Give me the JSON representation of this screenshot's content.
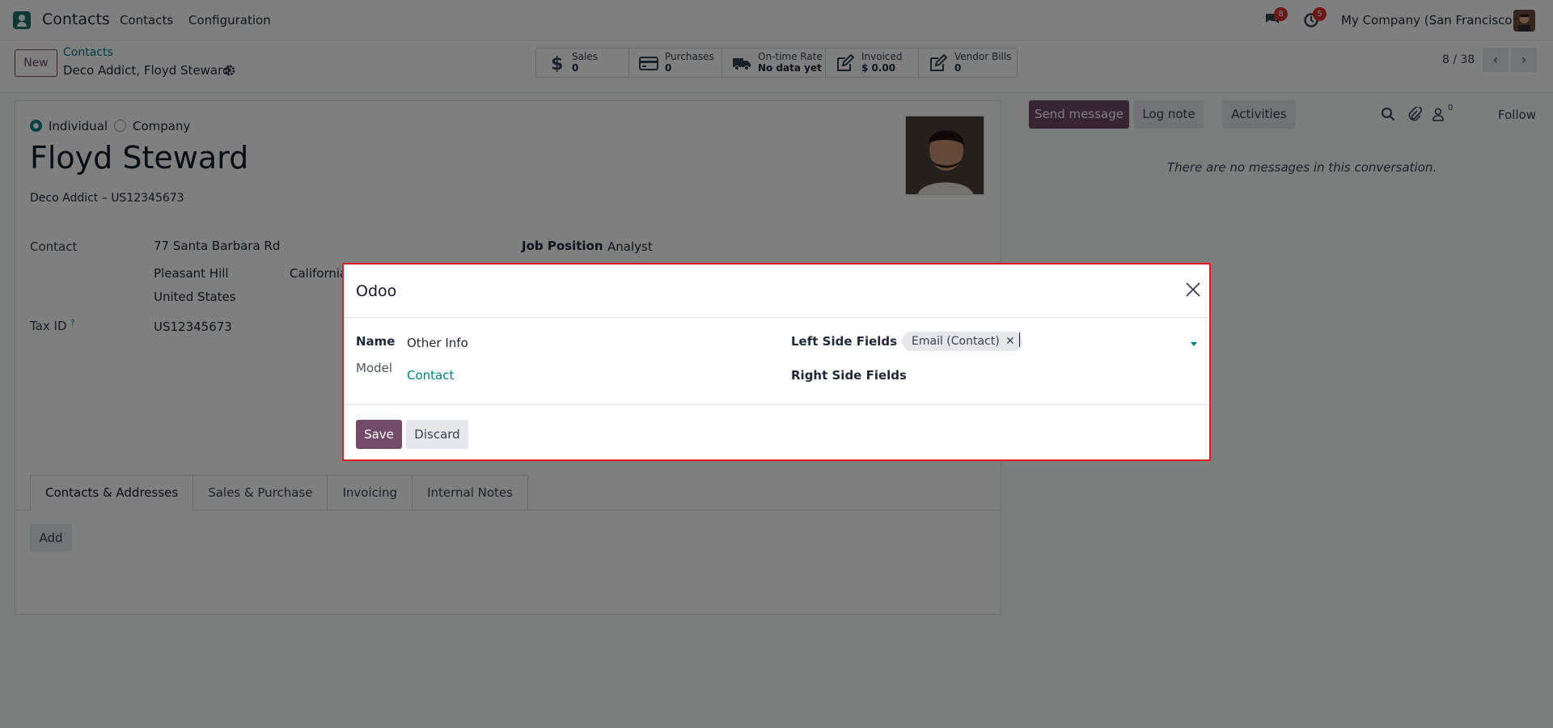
{
  "navbar": {
    "app_name": "Contacts",
    "menu": [
      "Contacts",
      "Configuration"
    ],
    "messages_badge": "8",
    "activities_badge": "5",
    "company": "My Company (San Francisco)"
  },
  "control_panel": {
    "new_label": "New",
    "breadcrumb_parent": "Contacts",
    "breadcrumb_current": "Deco Addict, Floyd Steward",
    "smart_buttons": [
      {
        "label": "Sales",
        "value": "0",
        "icon": "dollar-icon"
      },
      {
        "label": "Purchases",
        "value": "0",
        "icon": "credit-card-icon"
      },
      {
        "label": "On-time Rate",
        "value": "No data yet",
        "icon": "truck-icon"
      },
      {
        "label": "Invoiced",
        "value": "$ 0.00",
        "icon": "pencil-square-icon"
      },
      {
        "label": "Vendor Bills",
        "value": "0",
        "icon": "pencil-square-icon"
      }
    ],
    "pager": "8 / 38"
  },
  "form": {
    "type_individual": "Individual",
    "type_company": "Company",
    "name": "Floyd Steward",
    "subtitle": "Deco Addict – US12345673",
    "contact_label": "Contact",
    "street": "77 Santa Barbara Rd",
    "city": "Pleasant Hill",
    "state": "California",
    "country": "United States",
    "tax_label": "Tax ID",
    "tax_help": "?",
    "tax_value": "US12345673",
    "job_label": "Job Position",
    "job_value": "Analyst",
    "tabs": [
      "Contacts & Addresses",
      "Sales & Purchase",
      "Invoicing",
      "Internal Notes"
    ],
    "add_label": "Add"
  },
  "chatter": {
    "send_message": "Send message",
    "log_note": "Log note",
    "activities": "Activities",
    "followers_count": "0",
    "follow": "Follow",
    "empty_text": "There are no messages in this conversation."
  },
  "dialog": {
    "title": "Odoo",
    "name_label": "Name",
    "name_value": "Other Info",
    "model_label": "Model",
    "model_value": "Contact",
    "left_fields_label": "Left Side Fields",
    "left_fields_tag": "Email (Contact)",
    "right_fields_label": "Right Side Fields",
    "save_label": "Save",
    "discard_label": "Discard"
  }
}
